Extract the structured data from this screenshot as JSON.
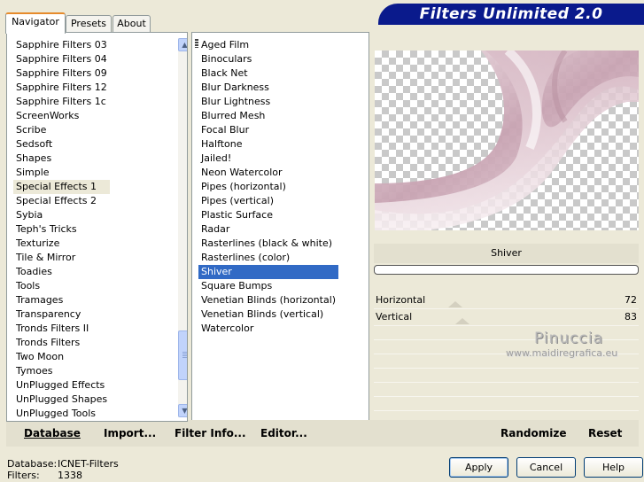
{
  "tabs": [
    {
      "label": "Navigator",
      "active": true
    },
    {
      "label": "Presets",
      "active": false
    },
    {
      "label": "About",
      "active": false
    }
  ],
  "banner_title": "Filters Unlimited 2.0",
  "categories": {
    "items": [
      "Sapphire Filters 03",
      "Sapphire Filters 04",
      "Sapphire Filters 09",
      "Sapphire Filters 12",
      "Sapphire Filters 1c",
      "ScreenWorks",
      "Scribe",
      "Sedsoft",
      "Shapes",
      "Simple",
      "Special Effects 1",
      "Special Effects 2",
      "Sybia",
      "Teph's Tricks",
      "Texturize",
      "Tile & Mirror",
      "Toadies",
      "Tools",
      "Tramages",
      "Transparency",
      "Tronds Filters II",
      "Tronds Filters",
      "Two Moon",
      "Tymoes",
      "UnPlugged Effects",
      "UnPlugged Shapes",
      "UnPlugged Tools"
    ],
    "selected": "Special Effects 1"
  },
  "filters": {
    "items": [
      "Aged Film",
      "Binoculars",
      "Black Net",
      "Blur Darkness",
      "Blur Lightness",
      "Blurred Mesh",
      "Focal Blur",
      "Halftone",
      "Jailed!",
      "Neon Watercolor",
      "Pipes (horizontal)",
      "Pipes (vertical)",
      "Plastic Surface",
      "Radar",
      "Rasterlines (black & white)",
      "Rasterlines (color)",
      "Shiver",
      "Square Bumps",
      "Venetian Blinds (horizontal)",
      "Venetian Blinds (vertical)",
      "Watercolor"
    ],
    "selected": "Shiver"
  },
  "preview": {
    "filter_name": "Shiver",
    "tint_color": "#c8a3b2"
  },
  "sliders": [
    {
      "label": "Horizontal",
      "value": "72",
      "level": 0.3
    },
    {
      "label": "Vertical",
      "value": "83",
      "level": 0.33
    }
  ],
  "watermark": {
    "name": "Pinuccia",
    "url": "www.maidiregrafica.eu"
  },
  "toolbar": {
    "database": "Database",
    "import": "Import...",
    "filter_info": "Filter Info...",
    "editor": "Editor...",
    "randomize": "Randomize",
    "reset": "Reset"
  },
  "status": {
    "database_label": "Database:",
    "database_value": "ICNET-Filters",
    "filters_label": "Filters:",
    "filters_value": "1338"
  },
  "buttons": {
    "apply": "Apply",
    "cancel": "Cancel",
    "help": "Help"
  },
  "icons": {
    "scroll_up": "scroll-up-icon",
    "scroll_down": "scroll-down-icon"
  }
}
